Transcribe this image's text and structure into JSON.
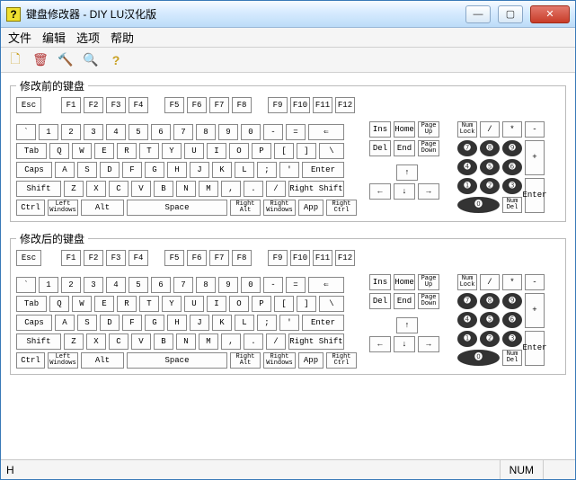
{
  "window": {
    "title": "键盘修改器 - DIY   LU汉化版"
  },
  "menu": {
    "file": "文件",
    "edit": "编辑",
    "options": "选项",
    "help": "帮助"
  },
  "toolbar": {
    "new": "🗋",
    "open": "🗑",
    "save": "🔨",
    "undo": "🔍",
    "helpq": "?"
  },
  "groups": {
    "before": "修改前的键盘",
    "after": "修改后的键盘"
  },
  "keys": {
    "esc": "Esc",
    "f1": "F1",
    "f2": "F2",
    "f3": "F3",
    "f4": "F4",
    "f5": "F5",
    "f6": "F6",
    "f7": "F7",
    "f8": "F8",
    "f9": "F9",
    "f10": "F10",
    "f11": "F11",
    "f12": "F12",
    "tilde": "`",
    "n1": "1",
    "n2": "2",
    "n3": "3",
    "n4": "4",
    "n5": "5",
    "n6": "6",
    "n7": "7",
    "n8": "8",
    "n9": "9",
    "n0": "0",
    "minus": "-",
    "equals": "=",
    "back": "⇐",
    "tab": "Tab",
    "q": "Q",
    "w": "W",
    "e": "E",
    "r": "R",
    "t": "T",
    "y": "Y",
    "u": "U",
    "i": "I",
    "o": "O",
    "p": "P",
    "lb": "[",
    "rb": "]",
    "bslash": "\\",
    "caps": "Caps",
    "a": "A",
    "s": "S",
    "d": "D",
    "f": "F",
    "g": "G",
    "h": "H",
    "j": "J",
    "k": "K",
    "l": "L",
    "semi": ";",
    "quote": "'",
    "enter": "Enter",
    "lshift": "Shift",
    "z": "Z",
    "x": "X",
    "c": "C",
    "v": "V",
    "b": "B",
    "nn": "N",
    "m": "M",
    "comma": ",",
    "period": ".",
    "slash": "/",
    "rshift": "Right Shift",
    "lctrl": "Ctrl",
    "lwin": "Left\nWindows",
    "lalt": "Alt",
    "space": "Space",
    "ralt": "Right\nAlt",
    "rwin": "Right\nWindows",
    "app": "App",
    "rctrl": "Right\nCtrl",
    "ins": "Ins",
    "home": "Home",
    "pgup": "Page\nUp",
    "del": "Del",
    "end": "End",
    "pgdn": "Page\nDown",
    "up": "↑",
    "left": "←",
    "down": "↓",
    "right": "→",
    "numlk": "Num\nLock",
    "npdiv": "/",
    "npmul": "*",
    "npsub": "-",
    "np7": "➐",
    "np8": "➑",
    "np9": "➒",
    "npadd": "+",
    "np4": "➍",
    "np5": "➎",
    "np6": "➏",
    "np1": "➊",
    "np2": "➋",
    "np3": "➌",
    "npent": "Enter",
    "np0": "⓿",
    "npdel": "Num\nDel"
  },
  "status": {
    "left": "H",
    "num": "NUM"
  }
}
